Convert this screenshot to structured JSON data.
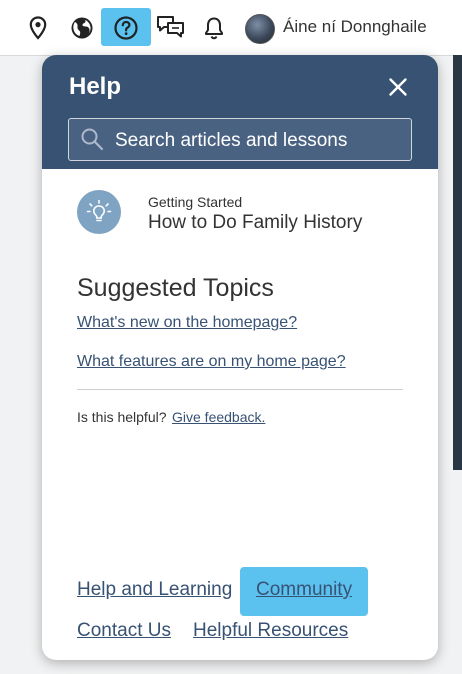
{
  "topbar": {
    "icons": [
      "location-pin-icon",
      "globe-icon",
      "help-icon",
      "messages-icon",
      "bell-icon"
    ],
    "user_name": "Áine ní Donnghaile"
  },
  "help_panel": {
    "title": "Help",
    "search": {
      "placeholder": "Search articles and lessons",
      "value": ""
    },
    "getting_started": {
      "kicker": "Getting Started",
      "title": "How to Do Family History",
      "icon": "lightbulb-icon"
    },
    "suggested_topics": {
      "heading": "Suggested Topics",
      "links": [
        "What's new on the homepage?",
        "What features are on my home page?"
      ]
    },
    "feedback": {
      "label": "Is this helpful?",
      "link": "Give feedback."
    },
    "footer_links": [
      "Help and Learning",
      "Community",
      "Contact Us",
      "Helpful Resources"
    ]
  },
  "colors": {
    "header_bg": "#385274",
    "link": "#385274",
    "highlight": "#5bc2f0",
    "tip_icon_bg": "#7fa3c3"
  }
}
